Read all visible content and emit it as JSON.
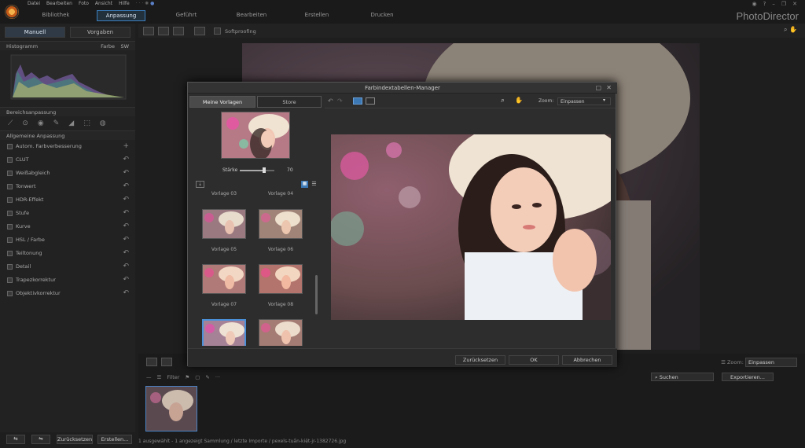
{
  "menu": [
    "Datei",
    "Bearbeiten",
    "Foto",
    "Ansicht",
    "Hilfe"
  ],
  "tabs": [
    "Bibliothek",
    "Anpassung",
    "Geführt",
    "Bearbeiten",
    "Erstellen",
    "Drucken"
  ],
  "brand": "PhotoDirector",
  "left_tabs": [
    "Manuell",
    "Vorgaben"
  ],
  "histogram": {
    "title": "Histogramm",
    "color": "Farbe",
    "bw": "SW"
  },
  "sections": {
    "bereich": "Bereichsanpassung",
    "allgemein": "Allgemeine Anpassung"
  },
  "adjustments": [
    {
      "label": "Autom. Farbverbesserung"
    },
    {
      "label": "CLUT"
    },
    {
      "label": "Weißabgleich"
    },
    {
      "label": "Tonwert"
    },
    {
      "label": "HDR-Effekt"
    },
    {
      "label": "Stufe"
    },
    {
      "label": "Kurve"
    },
    {
      "label": "HSL / Farbe"
    },
    {
      "label": "Teiltonung"
    },
    {
      "label": "Detail"
    },
    {
      "label": "Trapezkorrektur"
    },
    {
      "label": "Objektivkorrektur"
    }
  ],
  "left_footer": {
    "reset": "Zurücksetzen",
    "create": "Erstellen..."
  },
  "toolbar": {
    "softproof": "Softproofing"
  },
  "bottom": {
    "filter": "Filter",
    "search": "Suchen",
    "export": "Exportieren...",
    "zoom_label": "Zoom:",
    "zoom_value": "Einpassen"
  },
  "status": "1 ausgewählt - 1 angezeigt     Sammlung / letzte Importe / pexels-tuấn-kiệt-jr-1382726.jpg",
  "dialog": {
    "title": "Farbindextabellen-Manager",
    "tabs": [
      "Meine Vorlagen",
      "Store"
    ],
    "strength_label": "Stärke",
    "strength_value": "70",
    "strength_fraction": 0.7,
    "zoom_label": "Zoom:",
    "zoom_value": "Einpassen",
    "templates": [
      "Vorlage 03",
      "Vorlage 04",
      "Vorlage 05",
      "Vorlage 06",
      "Vorlage 07",
      "Vorlage 08"
    ],
    "buttons": {
      "reset": "Zurücksetzen",
      "ok": "OK",
      "cancel": "Abbrechen"
    }
  }
}
